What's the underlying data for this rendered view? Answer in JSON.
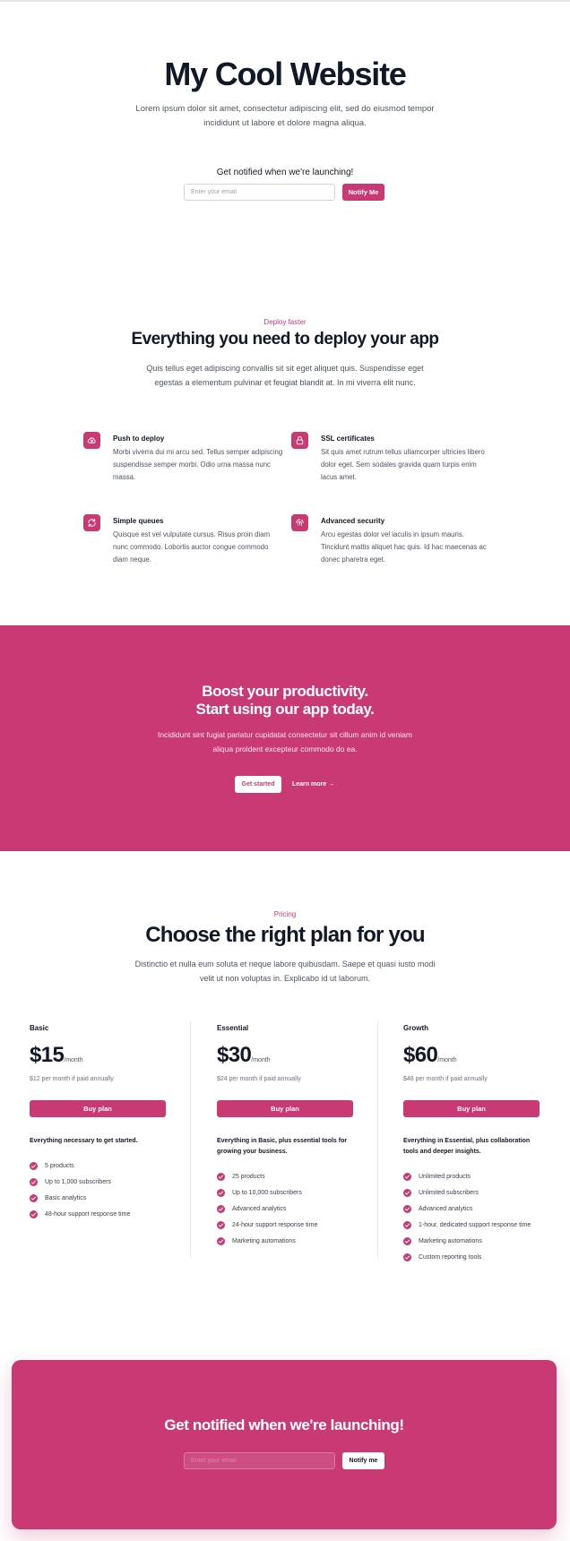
{
  "theme": {
    "accent": "#c93a74",
    "text": "#111827",
    "muted": "#4b5563"
  },
  "hero": {
    "title": "My Cool Website",
    "subtitle": "Lorem ipsum dolor sit amet, consectetur adipiscing elit, sed do eiusmod tempor incididunt ut labore et dolore magna aliqua.",
    "notify_label": "Get notified when we're launching!",
    "email_placeholder": "Enter your email",
    "notify_button": "Notify Me"
  },
  "features": {
    "eyebrow": "Deploy faster",
    "title": "Everything you need to deploy your app",
    "subtitle": "Quis tellus eget adipiscing convallis sit sit eget aliquet quis. Suspendisse eget egestas a elementum pulvinar et feugiat blandit at. In mi viverra elit nunc.",
    "items": [
      {
        "icon": "cloud-upload-icon",
        "title": "Push to deploy",
        "description": "Morbi viverra dui mi arcu sed. Tellus semper adipiscing suspendisse semper morbi. Odio urna massa nunc massa."
      },
      {
        "icon": "lock-icon",
        "title": "SSL certificates",
        "description": "Sit quis amet rutrum tellus ullamcorper ultricies libero dolor eget. Sem sodales gravida quam turpis enim lacus amet."
      },
      {
        "icon": "refresh-icon",
        "title": "Simple queues",
        "description": "Quisque est vel vulputate cursus. Risus proin diam nunc commodo. Lobortis auctor congue commodo diam neque."
      },
      {
        "icon": "fingerprint-icon",
        "title": "Advanced security",
        "description": "Arcu egestas dolor vel iaculis in ipsum mauris. Tincidunt mattis aliquet hac quis. Id hac maecenas ac donec pharetra eget."
      }
    ]
  },
  "cta": {
    "title_line1": "Boost your productivity.",
    "title_line2": "Start using our app today.",
    "subtitle": "Incididunt sint fugiat pariatur cupidatat consectetur sit cillum anim id veniam aliqua proident excepteur commodo do ea.",
    "primary_button": "Get started",
    "secondary_link": "Learn more →"
  },
  "pricing": {
    "eyebrow": "Pricing",
    "title": "Choose the right plan for you",
    "subtitle": "Distinctio et nulla eum soluta et neque labore quibusdam. Saepe et quasi iusto modi velit ut non voluptas in. Explicabo id ut laborum.",
    "buy_label": "Buy plan",
    "tiers": [
      {
        "name": "Basic",
        "price": "$15",
        "period": "/month",
        "annual": "$12 per month if paid annually",
        "tagline": "Everything necessary to get started.",
        "features": [
          "5 products",
          "Up to 1,000 subscribers",
          "Basic analytics",
          "48-hour support response time"
        ]
      },
      {
        "name": "Essential",
        "price": "$30",
        "period": "/month",
        "annual": "$24 per month if paid annually",
        "tagline": "Everything in Basic, plus essential tools for growing your business.",
        "features": [
          "25 products",
          "Up to 10,000 subscribers",
          "Advanced analytics",
          "24-hour support response time",
          "Marketing automations"
        ]
      },
      {
        "name": "Growth",
        "price": "$60",
        "period": "/month",
        "annual": "$48 per month if paid annually",
        "tagline": "Everything in Essential, plus collaboration tools and deeper insights.",
        "features": [
          "Unlimited products",
          "Unlimited subscribers",
          "Advanced analytics",
          "1-hour, dedicated support response time",
          "Marketing automations",
          "Custom reporting tools"
        ]
      }
    ]
  },
  "notify_card": {
    "title": "Get notified when we're launching!",
    "email_placeholder": "Enter your email",
    "button": "Notify me"
  }
}
